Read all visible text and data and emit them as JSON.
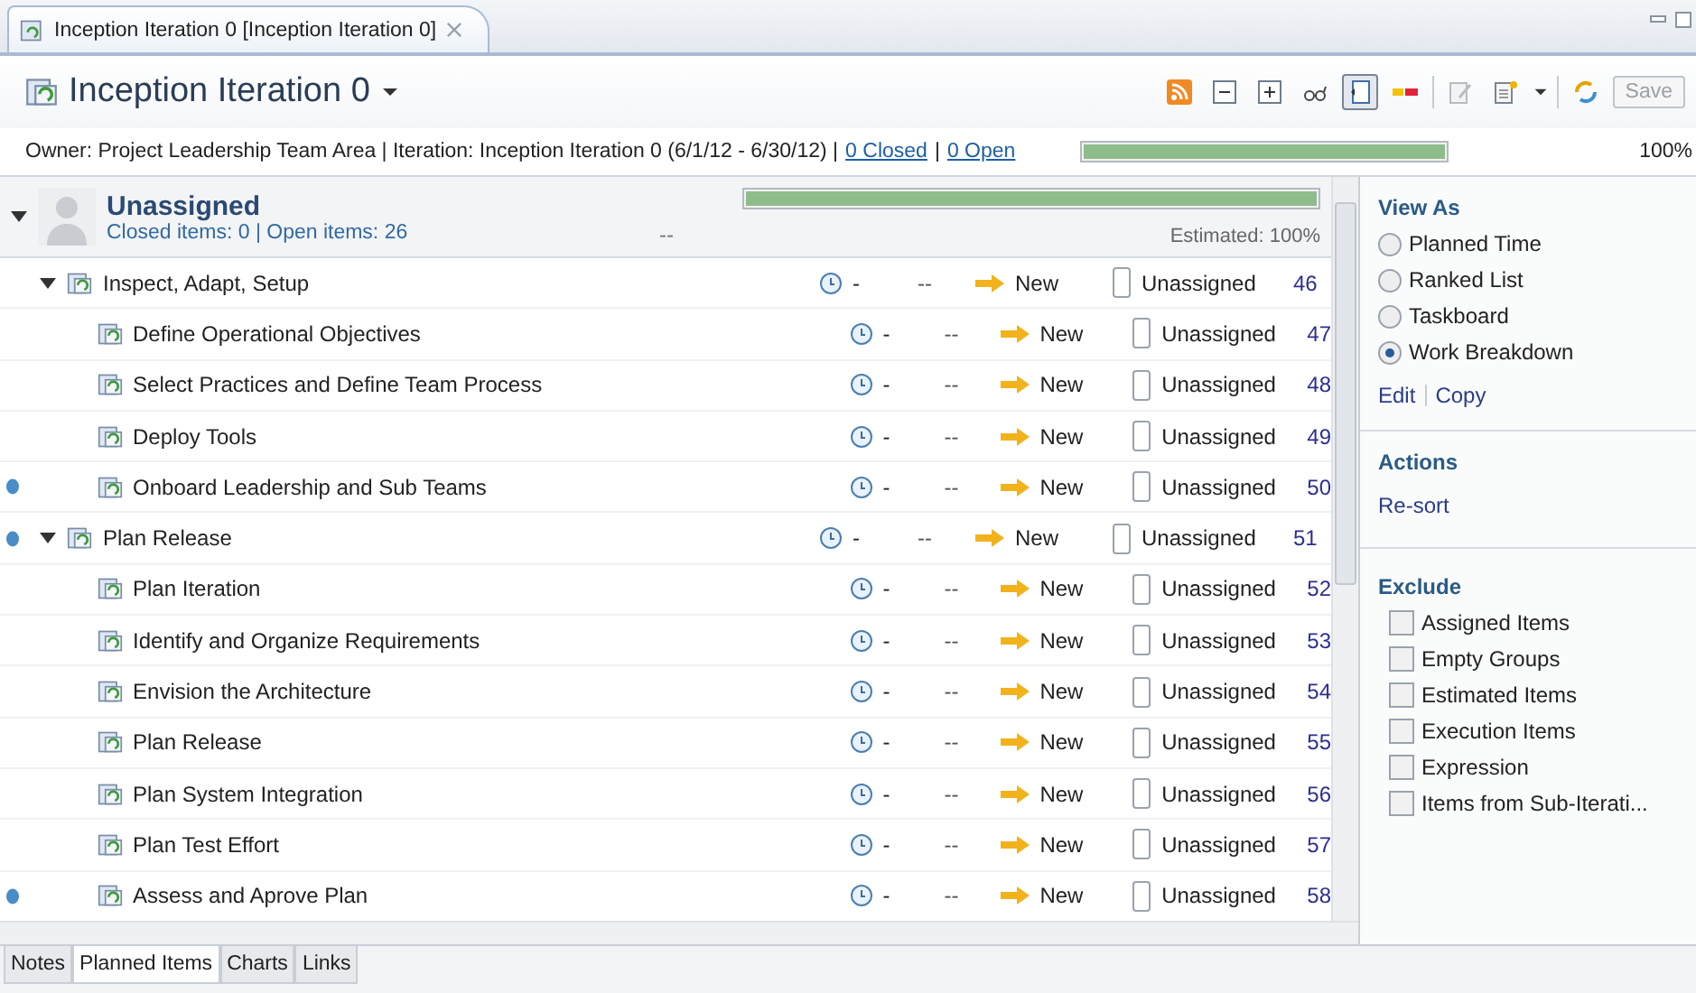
{
  "editor_tab": {
    "label": "Inception Iteration 0 [Inception Iteration 0]",
    "selected": true
  },
  "title": "Inception Iteration 0",
  "toolbar": [
    {
      "kind": "feed",
      "pressed": false
    },
    {
      "kind": "collapse",
      "pressed": false
    },
    {
      "kind": "expand",
      "pressed": false
    },
    {
      "kind": "glasses",
      "pressed": false
    },
    {
      "kind": "panel",
      "pressed": true
    },
    {
      "kind": "colors",
      "pressed": false
    },
    {
      "kind": "sep"
    },
    {
      "kind": "edit",
      "pressed": false
    },
    {
      "kind": "new",
      "pressed": false
    },
    {
      "kind": "sep"
    },
    {
      "kind": "sync",
      "pressed": false
    }
  ],
  "save_button": {
    "label": "Save",
    "disabled": true
  },
  "summary": {
    "text": "Owner: Project Leadership Team Area | Iteration: Inception Iteration 0 (6/1/12 - 6/30/12) |",
    "links": [
      "0 Closed",
      "0 Open"
    ],
    "separator": "|",
    "level": 1.0,
    "percent": "100%"
  },
  "group": {
    "name": "Unassigned",
    "expanded": true,
    "counts": "Closed items: 0 | Open items: 26",
    "dashes": "--",
    "level": 1.0,
    "estimated": "Estimated: 100%"
  },
  "items": [
    {
      "name": "Inspect, Adapt, Setup",
      "expanded": true,
      "flagged": false,
      "estimate": "-",
      "column_3": "--",
      "state": "New",
      "owner": "Unassigned",
      "id": "46",
      "children": [
        {
          "name": "Define Operational Objectives",
          "flagged": false,
          "estimate": "-",
          "column_3": "--",
          "state": "New",
          "owner": "Unassigned",
          "id": "47"
        },
        {
          "name": "Select Practices and Define Team Process",
          "flagged": false,
          "estimate": "-",
          "column_3": "--",
          "state": "New",
          "owner": "Unassigned",
          "id": "48"
        },
        {
          "name": "Deploy Tools",
          "flagged": false,
          "estimate": "-",
          "column_3": "--",
          "state": "New",
          "owner": "Unassigned",
          "id": "49"
        },
        {
          "name": "Onboard Leadership and Sub Teams",
          "flagged": true,
          "estimate": "-",
          "column_3": "--",
          "state": "New",
          "owner": "Unassigned",
          "id": "50"
        }
      ]
    },
    {
      "name": "Plan Release",
      "expanded": true,
      "flagged": true,
      "estimate": "-",
      "column_3": "--",
      "state": "New",
      "owner": "Unassigned",
      "id": "51",
      "children": [
        {
          "name": "Plan Iteration",
          "flagged": false,
          "estimate": "-",
          "column_3": "--",
          "state": "New",
          "owner": "Unassigned",
          "id": "52"
        },
        {
          "name": "Identify and Organize Requirements",
          "flagged": false,
          "estimate": "-",
          "column_3": "--",
          "state": "New",
          "owner": "Unassigned",
          "id": "53"
        },
        {
          "name": "Envision the Architecture",
          "flagged": false,
          "estimate": "-",
          "column_3": "--",
          "state": "New",
          "owner": "Unassigned",
          "id": "54"
        },
        {
          "name": "Plan Release",
          "flagged": false,
          "estimate": "-",
          "column_3": "--",
          "state": "New",
          "owner": "Unassigned",
          "id": "55"
        },
        {
          "name": "Plan System Integration",
          "flagged": false,
          "estimate": "-",
          "column_3": "--",
          "state": "New",
          "owner": "Unassigned",
          "id": "56"
        },
        {
          "name": "Plan Test Effort",
          "flagged": false,
          "estimate": "-",
          "column_3": "--",
          "state": "New",
          "owner": "Unassigned",
          "id": "57"
        },
        {
          "name": "Assess and Aprove Plan",
          "flagged": true,
          "estimate": "-",
          "column_3": "--",
          "state": "New",
          "owner": "Unassigned",
          "id": "58"
        }
      ]
    }
  ],
  "side_panel": {
    "view_as": {
      "title": "View As",
      "options": [
        {
          "label": "Planned Time",
          "selected": false
        },
        {
          "label": "Ranked List",
          "selected": false
        },
        {
          "label": "Taskboard",
          "selected": false
        },
        {
          "label": "Work Breakdown",
          "selected": true
        }
      ],
      "links": [
        "Edit",
        "Copy"
      ]
    },
    "actions": {
      "title": "Actions",
      "links": [
        "Re-sort"
      ]
    },
    "exclude": {
      "title": "Exclude",
      "options": [
        {
          "label": "Assigned Items",
          "checked": false
        },
        {
          "label": "Empty Groups",
          "checked": false
        },
        {
          "label": "Estimated Items",
          "checked": false
        },
        {
          "label": "Execution Items",
          "checked": false
        },
        {
          "label": "Expression",
          "checked": false
        },
        {
          "label": "Items from Sub-Iterati...",
          "checked": false
        }
      ]
    }
  },
  "bottom_tabs": [
    {
      "label": "Notes",
      "selected": false
    },
    {
      "label": "Planned Items",
      "selected": true
    },
    {
      "label": "Charts",
      "selected": false
    },
    {
      "label": "Links",
      "selected": false
    }
  ]
}
